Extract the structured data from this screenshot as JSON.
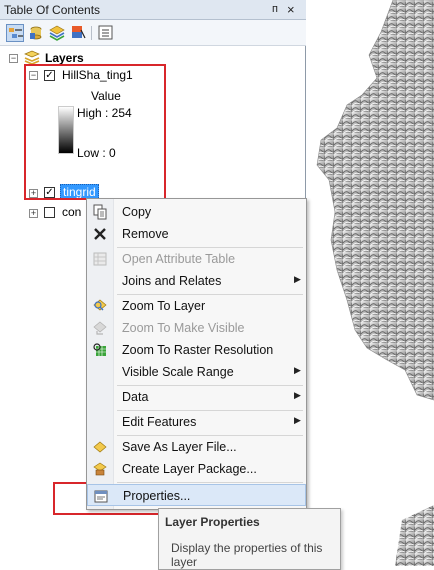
{
  "toc": {
    "title": "Table Of Contents",
    "pin": "p",
    "close": "×",
    "toolbar": [
      "list-by-drawing-order-icon",
      "list-by-source-icon",
      "list-by-visibility-icon",
      "list-by-selection-icon",
      "options-icon"
    ],
    "root": {
      "label": "Layers",
      "expander": "−"
    },
    "layer1": {
      "label": "HillSha_ting1",
      "checked": true,
      "expander": "−",
      "legend_title": "Value",
      "high": "High : 254",
      "low": "Low : 0"
    },
    "layer2": {
      "label": "tingrid",
      "checked": true,
      "expander": "+"
    },
    "layer3": {
      "label": "con",
      "checked": false,
      "expander": "+"
    }
  },
  "context_menu": {
    "items": [
      {
        "label": "Copy",
        "icon": "copy-icon",
        "enabled": true,
        "submenu": false
      },
      {
        "label": "Remove",
        "icon": "remove-icon",
        "enabled": true,
        "submenu": false
      },
      {
        "label": "Open Attribute Table",
        "icon": "table-icon",
        "enabled": false,
        "submenu": false
      },
      {
        "label": "Joins and Relates",
        "icon": "",
        "enabled": true,
        "submenu": true
      },
      {
        "label": "Zoom To Layer",
        "icon": "zoom-to-layer-icon",
        "enabled": true,
        "submenu": false
      },
      {
        "label": "Zoom To Make Visible",
        "icon": "zoom-visible-icon",
        "enabled": false,
        "submenu": false
      },
      {
        "label": "Zoom To Raster Resolution",
        "icon": "raster-resolution-icon",
        "enabled": true,
        "submenu": false
      },
      {
        "label": "Visible Scale Range",
        "icon": "",
        "enabled": true,
        "submenu": true
      },
      {
        "label": "Data",
        "icon": "",
        "enabled": true,
        "submenu": true
      },
      {
        "label": "Edit Features",
        "icon": "",
        "enabled": true,
        "submenu": true
      },
      {
        "label": "Save As Layer File...",
        "icon": "save-layer-icon",
        "enabled": true,
        "submenu": false
      },
      {
        "label": "Create Layer Package...",
        "icon": "layer-package-icon",
        "enabled": true,
        "submenu": false
      },
      {
        "label": "Properties...",
        "icon": "properties-icon",
        "enabled": true,
        "submenu": false,
        "highlighted": true
      }
    ]
  },
  "tooltip": {
    "title": "Layer Properties",
    "description": "Display the properties of this layer"
  },
  "colors": {
    "highlight_red": "#d8262b",
    "selection_blue": "#3399ff",
    "hover": "#dbe8f8"
  }
}
